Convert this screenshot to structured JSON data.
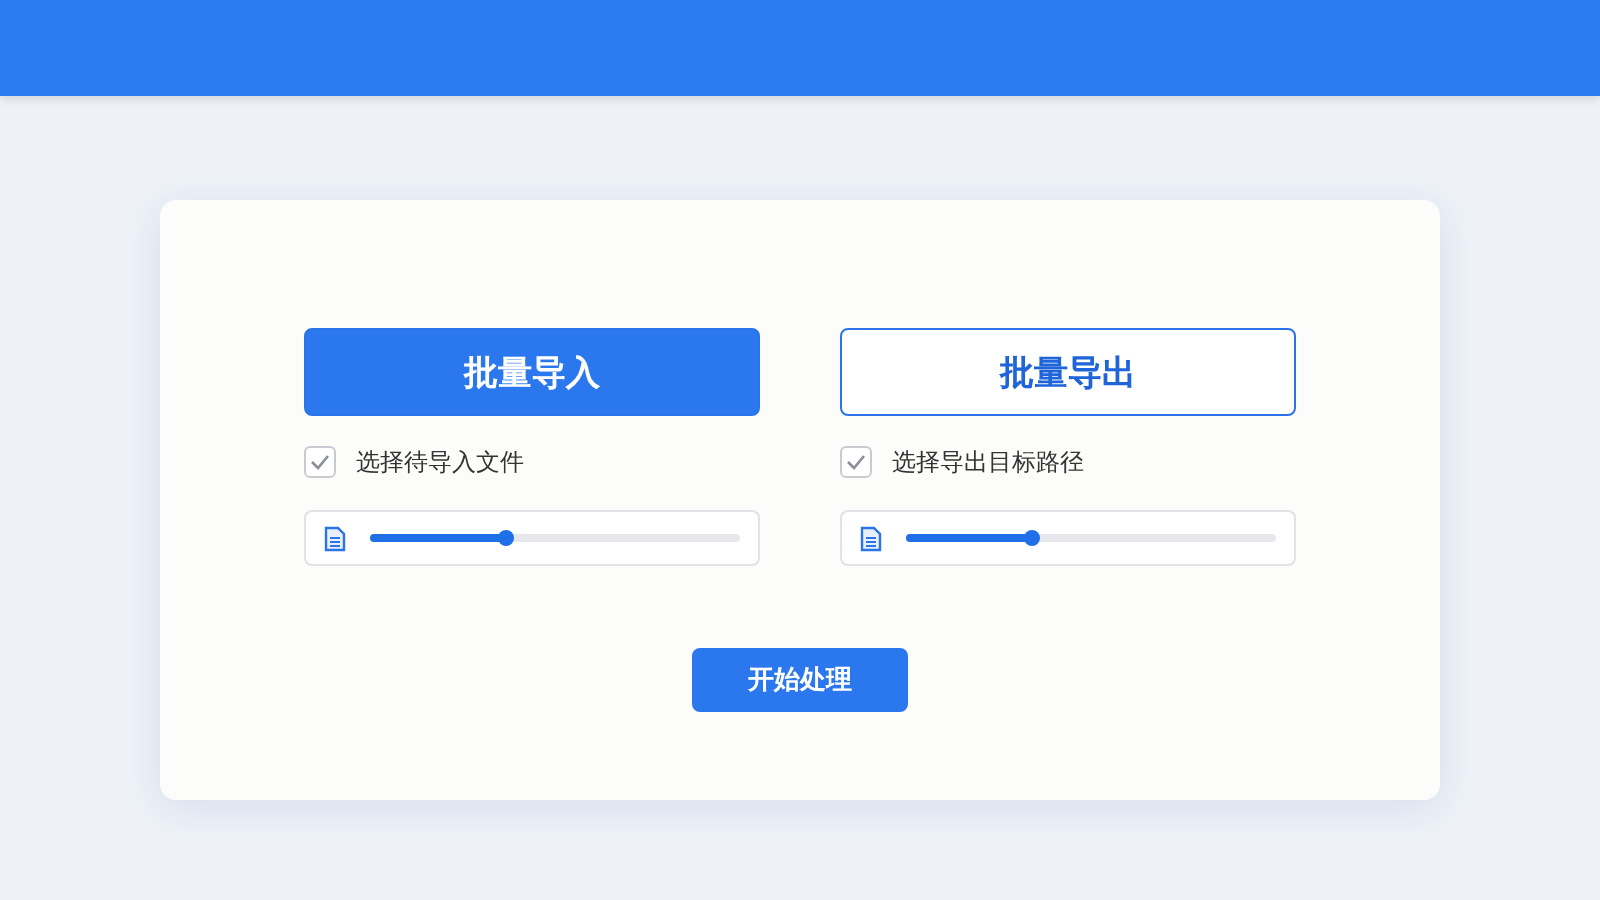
{
  "dialog": {
    "columns": [
      {
        "button": {
          "label": "批量导入",
          "selected": true
        },
        "option": {
          "label": "选择待导入文件",
          "checked": true
        },
        "slider": {
          "level": 0.37
        }
      },
      {
        "button": {
          "label": "批量导出",
          "selected": false
        },
        "option": {
          "label": "选择导出目标路径",
          "checked": true
        },
        "slider": {
          "level": 0.34
        }
      }
    ],
    "start_button": {
      "label": "开始处理"
    }
  }
}
